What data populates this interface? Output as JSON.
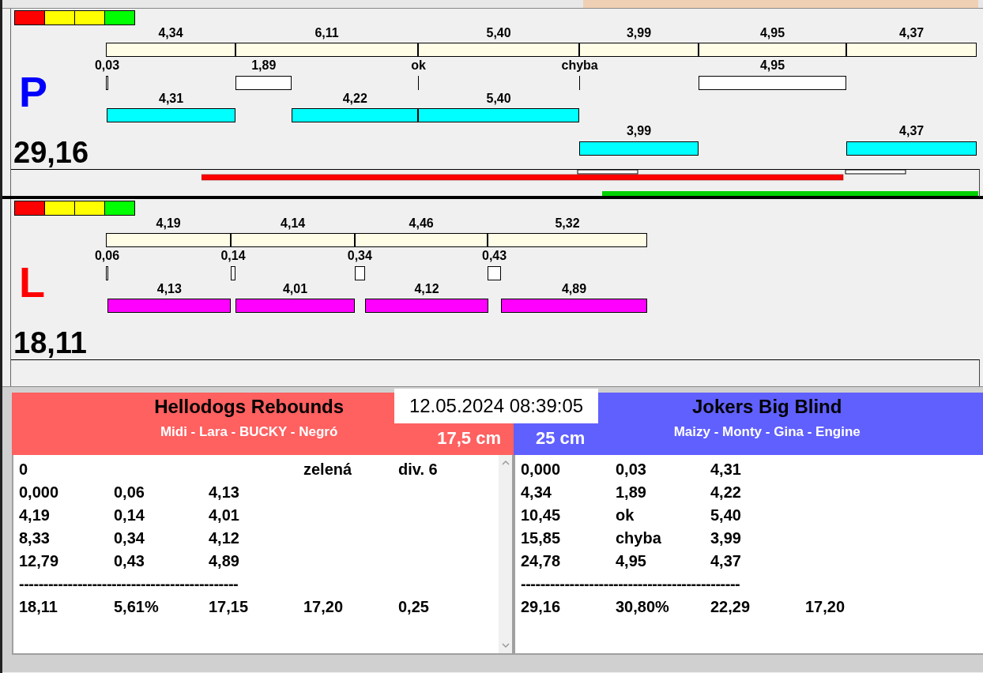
{
  "lanes": [
    {
      "letter": "P",
      "color": "#0000ff",
      "total": "29,16",
      "overlap_marks": true,
      "segments": [
        "4,34",
        "6,11",
        "5,40",
        "3,99",
        "4,95",
        "4,37"
      ],
      "crossings": [
        {
          "text": "0,03",
          "kind": "time"
        },
        {
          "text": "1,89",
          "kind": "time"
        },
        {
          "text": "ok",
          "kind": "ok"
        },
        {
          "text": "chyba",
          "kind": "fault"
        },
        {
          "text": "4,95",
          "kind": "time"
        }
      ],
      "runs": [
        {
          "time": "4,31",
          "color": "#00ffff"
        },
        {
          "time": "4,22",
          "color": "#00ffff"
        },
        {
          "time": "5,40",
          "color": "#00ffff"
        },
        {
          "time": "3,99",
          "color": "#00ffff"
        },
        {
          "time": "4,37",
          "color": "#00ffff"
        }
      ]
    },
    {
      "letter": "L",
      "color": "#ff0000",
      "total": "18,11",
      "overlap_marks": false,
      "segments": [
        "4,19",
        "4,14",
        "4,46",
        "5,32"
      ],
      "crossings": [
        {
          "text": "0,06",
          "kind": "time"
        },
        {
          "text": "0,14",
          "kind": "time"
        },
        {
          "text": "0,34",
          "kind": "time"
        },
        {
          "text": "0,43",
          "kind": "time"
        }
      ],
      "runs": [
        {
          "time": "4,13",
          "color": "#ff00ff"
        },
        {
          "time": "4,01",
          "color": "#ff00ff"
        },
        {
          "time": "4,12",
          "color": "#ff00ff"
        },
        {
          "time": "4,89",
          "color": "#ff00ff"
        }
      ]
    }
  ],
  "datetime": "12.05.2024 08:39:05",
  "teams": [
    {
      "name": "Hellodogs Rebounds",
      "dogs": "Midi - Lara - BUCKY - Negró",
      "height": "17,5 cm",
      "color": "#ff6060",
      "rows": [
        {
          "kind": "data",
          "cells": [
            "0",
            null,
            null,
            "zelená",
            "div. 6"
          ]
        },
        {
          "kind": "data",
          "cells": [
            "0,000",
            "0,06",
            "4,13"
          ]
        },
        {
          "kind": "data",
          "cells": [
            "4,19",
            "0,14",
            "4,01"
          ]
        },
        {
          "kind": "data",
          "cells": [
            "8,33",
            "0,34",
            "4,12"
          ]
        },
        {
          "kind": "data",
          "cells": [
            "12,79",
            "0,43",
            "4,89"
          ]
        },
        {
          "kind": "separator",
          "text": "---------------------------------------------"
        },
        {
          "kind": "data",
          "cells": [
            "18,11",
            "5,61%",
            "17,15",
            "17,20",
            "0,25"
          ]
        }
      ]
    },
    {
      "name": "Jokers Big Blind",
      "dogs": "Maizy - Monty - Gina - Engine",
      "height": "25 cm",
      "color": "#6060ff",
      "rows": [
        {
          "kind": "data",
          "cells": [
            "0,000",
            "0,03",
            "4,31"
          ]
        },
        {
          "kind": "data",
          "cells": [
            "4,34",
            "1,89",
            "4,22"
          ]
        },
        {
          "kind": "data",
          "cells": [
            "10,45",
            "ok",
            "5,40"
          ]
        },
        {
          "kind": "data",
          "cells": [
            "15,85",
            "chyba",
            "3,99"
          ]
        },
        {
          "kind": "data",
          "cells": [
            "24,78",
            "4,95",
            "4,37"
          ]
        },
        {
          "kind": "separator",
          "text": "---------------------------------------------"
        },
        {
          "kind": "data",
          "cells": [
            "29,16",
            "30,80%",
            "22,29",
            "17,20"
          ]
        }
      ]
    }
  ]
}
